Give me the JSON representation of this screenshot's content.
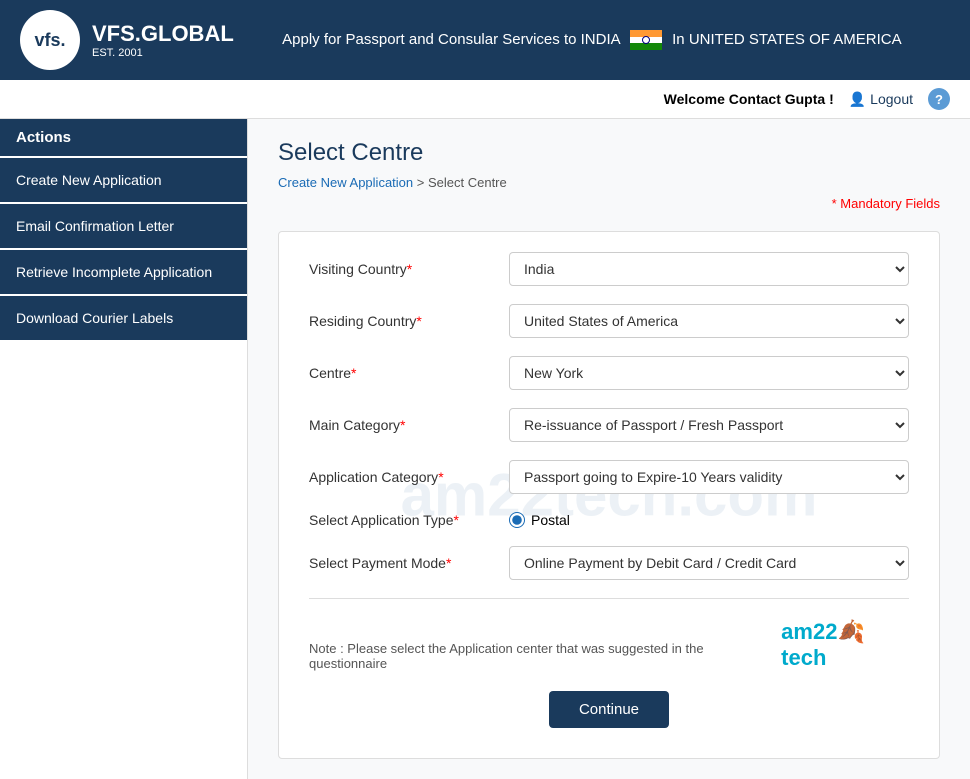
{
  "header": {
    "logo_text": "vfs.",
    "brand": "VFS.GLOBAL",
    "est": "EST. 2001",
    "tagline": "Apply for Passport and Consular Services to INDIA",
    "country": "In UNITED STATES OF AMERICA"
  },
  "topbar": {
    "welcome": "Welcome Contact Gupta !",
    "logout": "Logout",
    "help": "?"
  },
  "sidebar": {
    "header": "Actions",
    "items": [
      {
        "label": "Create New Application"
      },
      {
        "label": "Email Confirmation Letter"
      },
      {
        "label": "Retrieve Incomplete Application"
      },
      {
        "label": "Download Courier Labels"
      }
    ]
  },
  "main": {
    "page_title": "Select Centre",
    "breadcrumb_1": "Create New Application",
    "breadcrumb_sep": " > ",
    "breadcrumb_2": "Select Centre",
    "mandatory_label": "Mandatory Fields",
    "watermark": "am22tech.com"
  },
  "form": {
    "visiting_country_label": "Visiting Country",
    "visiting_country_value": "India",
    "visiting_country_options": [
      "India"
    ],
    "residing_country_label": "Residing Country",
    "residing_country_value": "United States of America",
    "residing_country_options": [
      "United States of America"
    ],
    "centre_label": "Centre",
    "centre_value": "New York",
    "centre_options": [
      "New York"
    ],
    "main_category_label": "Main Category",
    "main_category_value": "Re-issuance of Passport / Fresh Passport",
    "main_category_options": [
      "Re-issuance of Passport / Fresh Passport"
    ],
    "app_category_label": "Application Category",
    "app_category_value": "Passport going to Expire-10 Years validity",
    "app_category_options": [
      "Passport going to Expire-10 Years validity"
    ],
    "app_type_label": "Select Application Type",
    "app_type_value": "Postal",
    "payment_mode_label": "Select Payment Mode",
    "payment_mode_value": "Online Payment by Debit Card / Credit Card",
    "payment_mode_options": [
      "Online Payment by Debit Card / Credit Card"
    ],
    "note": "Note : Please select the Application center that was suggested in the questionnaire",
    "continue_btn": "Continue"
  }
}
